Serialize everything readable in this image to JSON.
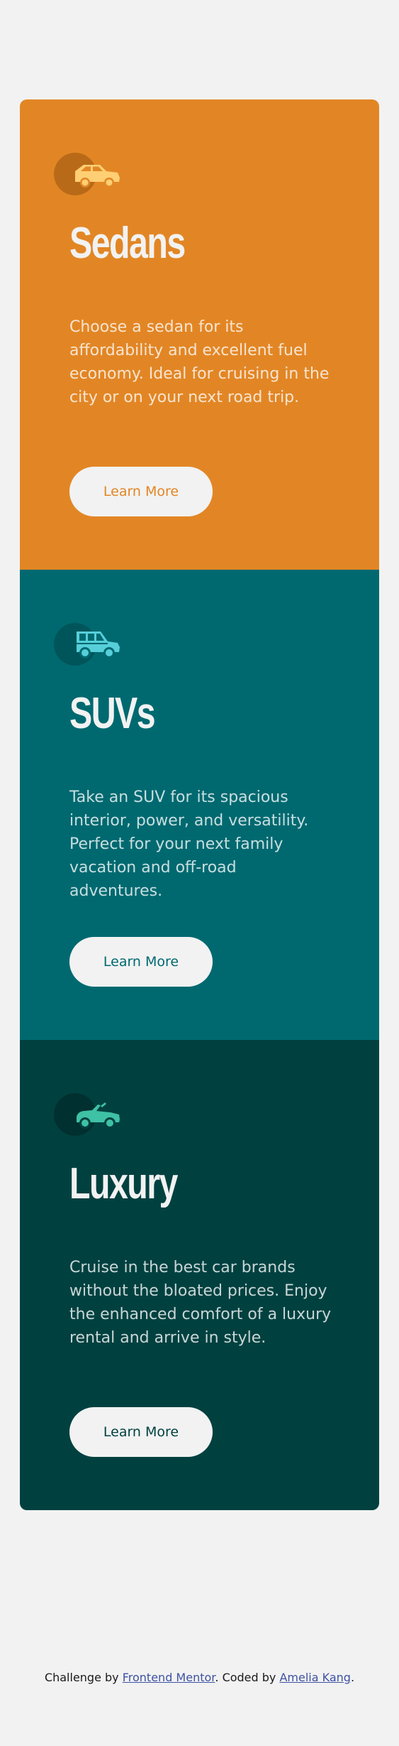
{
  "cards": [
    {
      "title": "Sedans",
      "description": "Choose a sedan for its affordability and excellent fuel economy. Ideal for cruising in the city or on your next road trip.",
      "button_label": "Learn More",
      "icon": "sedan-car-icon",
      "color": "#e28625"
    },
    {
      "title": "SUVs",
      "description": "Take an SUV for its spacious interior, power, and versatility. Perfect for your next family vacation and off-road adventures.",
      "button_label": "Learn More",
      "icon": "suv-car-icon",
      "color": "#006970"
    },
    {
      "title": "Luxury",
      "description": "Cruise in the best car brands without the bloated prices. Enjoy the enhanced comfort of a luxury rental and arrive in style.",
      "button_label": "Learn More",
      "icon": "luxury-car-icon",
      "color": "#004140"
    }
  ],
  "footer": {
    "prefix": "Challenge by",
    "link1": "Frontend Mentor",
    "middle": ". Coded by",
    "link2": "Amelia Kang",
    "suffix": "."
  },
  "colors": {
    "background": "#f2f2f2",
    "link": "#3e52a3"
  }
}
